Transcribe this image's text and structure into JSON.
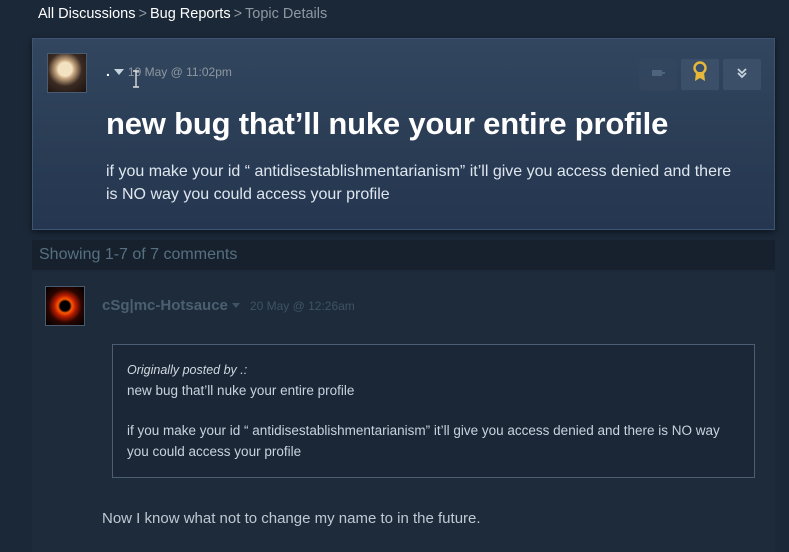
{
  "breadcrumb": {
    "items": [
      "All Discussions",
      "Bug Reports"
    ],
    "separator": ">",
    "current": "Topic Details"
  },
  "topic": {
    "author": ".",
    "timestamp": "19 May @ 11:02pm",
    "title": "new bug that’ll nuke your entire profile",
    "body": "if you make your id “ antidisestablishmentarianism” it’ll give you access denied and there is NO way you could access your profile",
    "buttons": [
      {
        "icon": "flag-icon"
      },
      {
        "icon": "award-icon"
      },
      {
        "icon": "double-chevron-down-icon"
      }
    ]
  },
  "comments_header": "Showing 1-7 of 7 comments",
  "comments": [
    {
      "author": "cSg|mc-Hotsauce",
      "timestamp": "20 May @ 12:26am",
      "quote": {
        "header": "Originally posted by .:",
        "line1": "new bug that’ll nuke your entire profile",
        "line2": "if you make your id “ antidisestablishmentarianism” it’ll give you access denied and there is NO way you could access your profile"
      },
      "text": "Now I know what not to change my name to in the future."
    }
  ],
  "colors": {
    "background": "#1b2838",
    "topic_panel": "#2a3d55",
    "award_gold": "#e5b73b"
  }
}
